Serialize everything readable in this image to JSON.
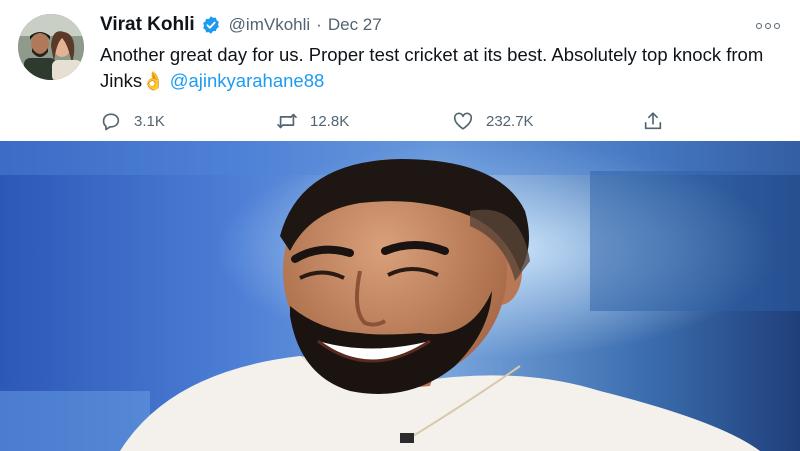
{
  "tweet": {
    "author_name": "Virat Kohli",
    "handle": "@imVkohli",
    "separator": "·",
    "date": "Dec 27",
    "text_line": "Another great day for us. Proper test cricket at its best. Absolutely top knock from Jinks",
    "emoji": "👌",
    "mention": "@ajinkyarahane88",
    "replies": "3.1K",
    "retweets": "12.8K",
    "likes": "232.7K"
  },
  "icons": {
    "verified": "verified-badge-icon",
    "more": "more-options-icon",
    "reply": "reply-icon",
    "retweet": "retweet-icon",
    "like": "heart-icon",
    "share": "share-icon"
  },
  "colors": {
    "accent": "#1d9bf0",
    "secondary_text": "#536471",
    "primary_text": "#0f1419"
  }
}
